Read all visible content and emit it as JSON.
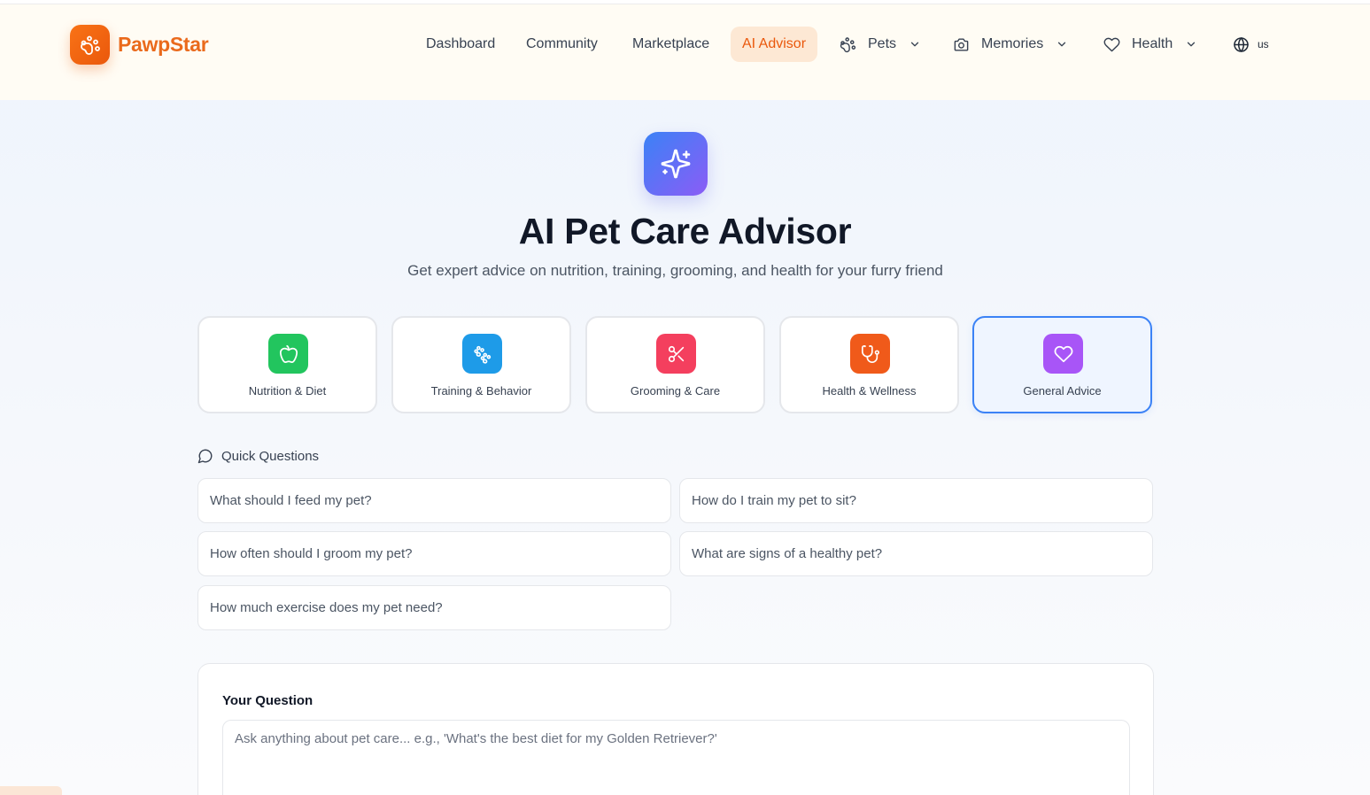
{
  "app": {
    "name": "PawpStar",
    "brand_color": "#ea580c",
    "logo_icon": "paw-icon"
  },
  "nav": {
    "dashboard": "Dashboard",
    "community": "Community",
    "marketplace": "Marketplace",
    "ai_advisor": "AI Advisor",
    "pets": "Pets",
    "memories": "Memories",
    "health": "Health",
    "language": "us",
    "active": "AI Advisor"
  },
  "hero": {
    "icon": "sparkles-icon",
    "title": "AI Pet Care Advisor",
    "subtitle": "Get expert advice on nutrition, training, grooming, and health for your furry friend"
  },
  "categories": [
    {
      "label": "Nutrition & Diet",
      "icon": "apple-icon",
      "color": "#22c55e",
      "selected": false
    },
    {
      "label": "Training & Behavior",
      "icon": "paw-training-icon",
      "color": "#1e9be8",
      "selected": false
    },
    {
      "label": "Grooming & Care",
      "icon": "scissors-icon",
      "color": "#f43f5e",
      "selected": false
    },
    {
      "label": "Health & Wellness",
      "icon": "stethoscope-icon",
      "color": "#f05a1a",
      "selected": false
    },
    {
      "label": "General Advice",
      "icon": "heart-icon",
      "color": "#a855f7",
      "selected": true
    }
  ],
  "quick_questions": {
    "heading": "Quick Questions",
    "items": [
      "What should I feed my pet?",
      "How do I train my pet to sit?",
      "How often should I groom my pet?",
      "What are signs of a healthy pet?",
      "How much exercise does my pet need?"
    ]
  },
  "question_form": {
    "label": "Your Question",
    "placeholder": "Ask anything about pet care... e.g., 'What's the best diet for my Golden Retriever?'",
    "value": ""
  }
}
